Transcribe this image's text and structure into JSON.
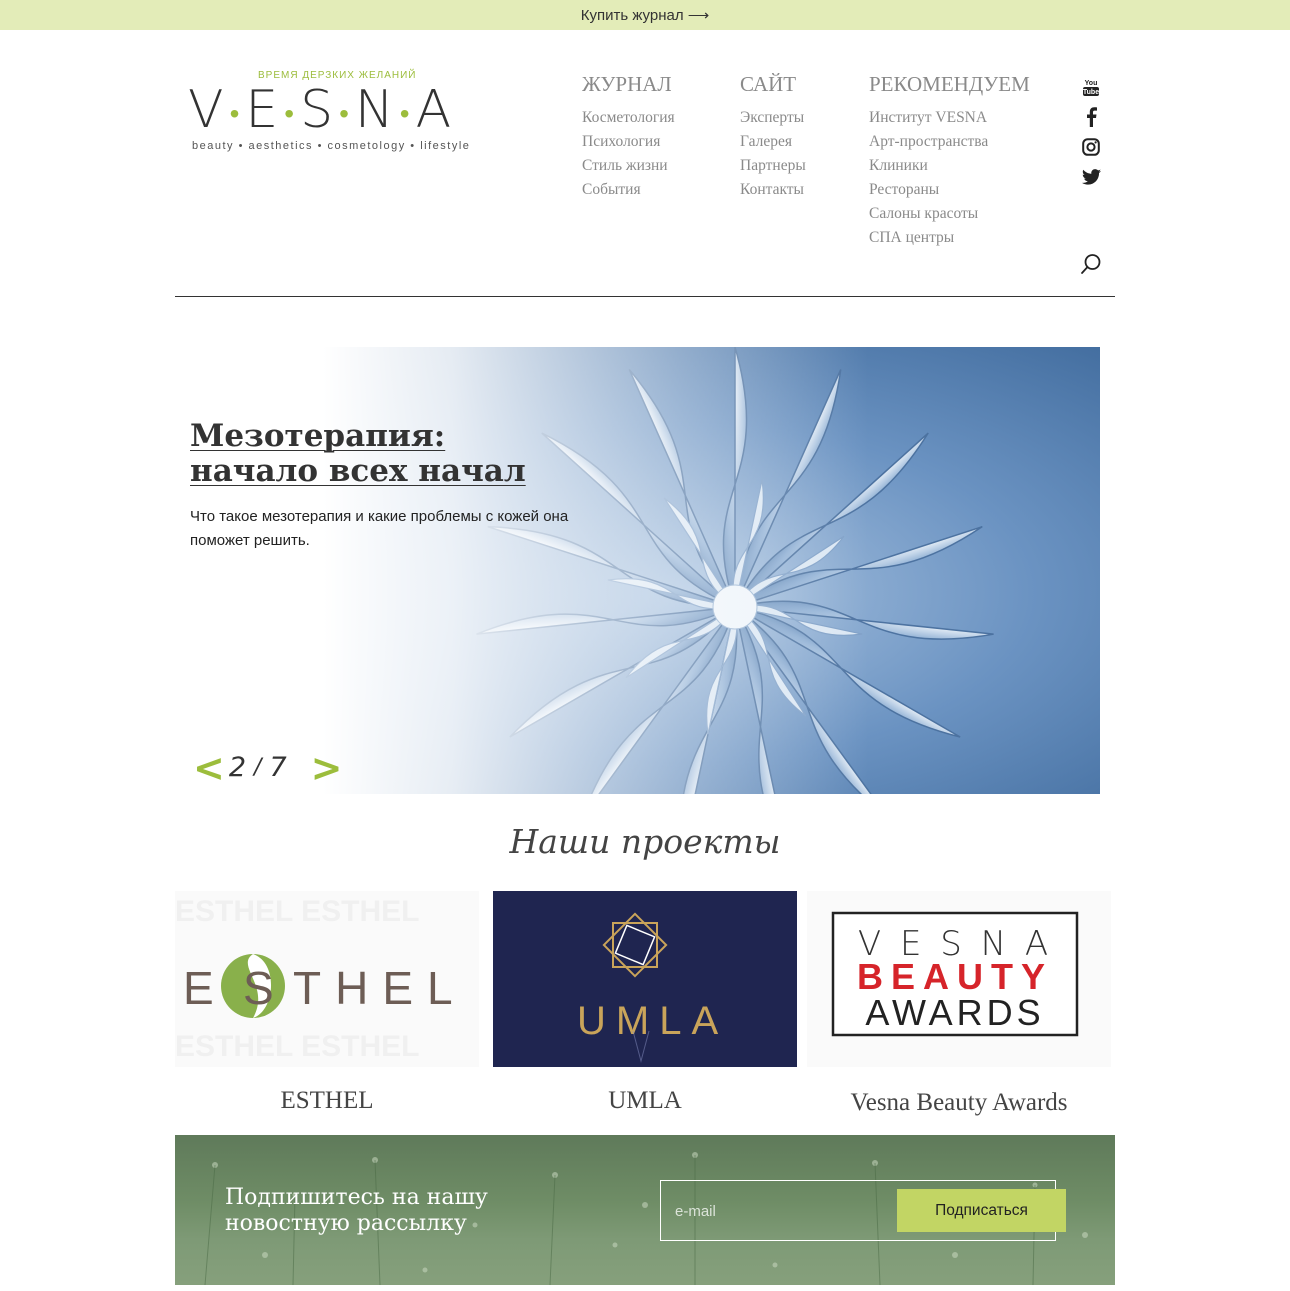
{
  "topbar": {
    "buy_label": "Купить журнал ⟶"
  },
  "logo": {
    "tagline_top": "ВРЕМЯ ДЕРЗКИХ ЖЕЛАНИЙ",
    "letters": [
      "V",
      "E",
      "S",
      "N",
      "A"
    ],
    "tagline_bottom": "beauty • aesthetics • cosmetology • lifestyle"
  },
  "nav": {
    "columns": [
      {
        "title": "ЖУРНАЛ",
        "items": [
          "Косметология",
          "Психология",
          "Стиль жизни",
          "События"
        ]
      },
      {
        "title": "САЙТ",
        "items": [
          "Эксперты",
          "Галерея",
          "Партнеры",
          "Контакты"
        ]
      },
      {
        "title": "РЕКОМЕНДУЕМ",
        "items": [
          "Институт VESNA",
          "Арт-пространства",
          "Клиники",
          "Рестораны",
          "Салоны красоты",
          "СПА центры"
        ]
      }
    ]
  },
  "social": [
    "youtube-icon",
    "facebook-icon",
    "instagram-icon",
    "twitter-icon"
  ],
  "hero": {
    "title": "Мезотерапия: начало всех начал",
    "description": "Что такое мезотерапия и какие проблемы с кожей она поможет решить.",
    "pager": {
      "prev": "<",
      "current": "2",
      "separator": "/",
      "total": "7",
      "next": ">"
    }
  },
  "projects": {
    "title": "Наши проекты",
    "items": [
      {
        "label": "ESTHEL",
        "logo_text": "THEL",
        "logo_prefix": "E"
      },
      {
        "label": "UMLA",
        "logo_text": "UMLA"
      },
      {
        "label": "Vesna Beauty Awards",
        "logo_line1": "V E S N A",
        "logo_line2": "BEAUTY",
        "logo_line3": "AWARDS"
      }
    ]
  },
  "subscribe": {
    "title": "Подпишитесь на нашу новостную рассылку",
    "placeholder": "e-mail",
    "button": "Подписаться"
  },
  "colors": {
    "accent": "#9cbd3c",
    "topbar": "#e3ecb8",
    "button": "#c2d564",
    "umla_bg": "#1f2550"
  }
}
